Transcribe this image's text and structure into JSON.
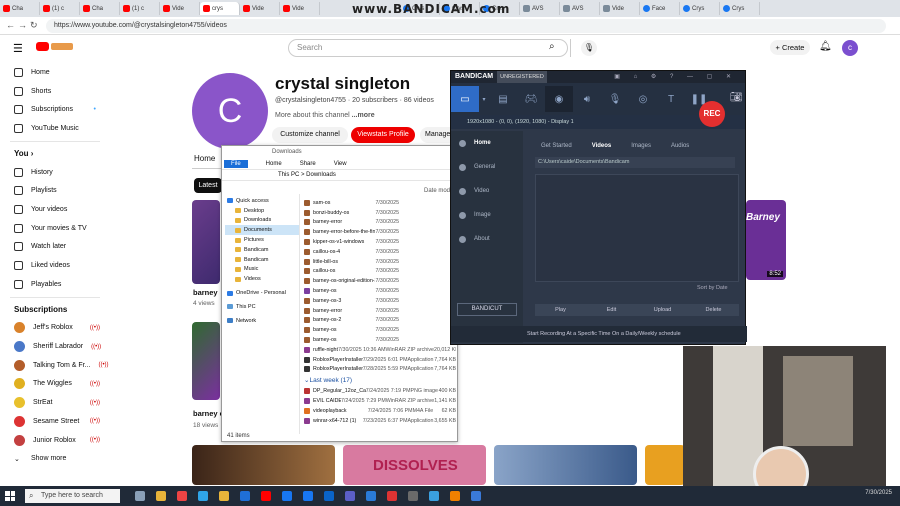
{
  "browser": {
    "tabs": [
      {
        "label": "Cha",
        "icon": "youtube-icon"
      },
      {
        "label": "(1) c",
        "icon": "youtube-icon"
      },
      {
        "label": "Cha",
        "icon": "youtube-icon"
      },
      {
        "label": "(1) c",
        "icon": "youtube-icon"
      },
      {
        "label": "Vide",
        "icon": "youtube-icon"
      },
      {
        "label": "crys",
        "icon": "youtube-icon",
        "active": true
      },
      {
        "label": "Vide",
        "icon": "youtube-icon"
      },
      {
        "label": "Vide",
        "icon": "youtube-icon"
      },
      {
        "label": "Crys",
        "icon": "facebook-icon"
      },
      {
        "label": "Crys",
        "icon": "facebook-icon"
      },
      {
        "label": "Crys",
        "icon": "facebook-icon"
      },
      {
        "label": "AVS",
        "icon": "other-icon"
      },
      {
        "label": "AVS",
        "icon": "other-icon"
      },
      {
        "label": "Vide",
        "icon": "other-icon"
      },
      {
        "label": "Face",
        "icon": "facebook-icon"
      },
      {
        "label": "Crys",
        "icon": "facebook-icon"
      },
      {
        "label": "Crys",
        "icon": "facebook-icon"
      }
    ],
    "watermark": "www.BANDICAM.com",
    "url": "https://www.youtube.com/@crystalsingleton4755/videos"
  },
  "youtube": {
    "search_placeholder": "Search",
    "create_label": "Create",
    "avatar_letter": "c",
    "sidebar": {
      "main": [
        "Home",
        "Shorts",
        "Subscriptions",
        "YouTube Music"
      ],
      "you_heading": "You",
      "you_items": [
        "History",
        "Playlists",
        "Your videos",
        "Your movies & TV",
        "Watch later",
        "Liked videos",
        "Playables"
      ],
      "subs_heading": "Subscriptions",
      "subs": [
        {
          "name": "Jeff's Roblox",
          "color": "#d9822b"
        },
        {
          "name": "Sheriff Labrador",
          "color": "#4a78c8"
        },
        {
          "name": "Talking Tom & Fr...",
          "color": "#b35d2a"
        },
        {
          "name": "The Wiggles",
          "color": "#e0b020"
        },
        {
          "name": "StrEat",
          "color": "#e8c02c"
        },
        {
          "name": "Sesame Street",
          "color": "#d33"
        },
        {
          "name": "Junior Roblox",
          "color": "#c34040"
        }
      ],
      "show_more": "Show more"
    },
    "channel": {
      "avatar_letter": "C",
      "name": "crystal singleton",
      "handle_line": "@crystalsingleton4755 · 20 subscribers · 86 videos",
      "more_about": "More about this channel",
      "more_link": "...more",
      "customize_label": "Customize channel",
      "viewstats_label": "Viewstats Profile",
      "manage_label": "Manage",
      "home_tab": "Home",
      "latest_chip": "Latest",
      "video_a_title": "barney",
      "video_a_meta": "4 views",
      "video_b_title": "barney er",
      "video_b_meta": "18 views",
      "right_thumb_text": "Barney",
      "right_thumb_duration": "8:52",
      "bottom_thumb_text": "DISSOLVES"
    }
  },
  "explorer": {
    "title": "Downloads",
    "ribbon": [
      "File",
      "Home",
      "Share",
      "View"
    ],
    "address": "This PC  >  Downloads",
    "header_date": "Date mod",
    "nav": [
      {
        "label": "Quick access",
        "icon": "star-icon",
        "indent": 0
      },
      {
        "label": "Desktop",
        "icon": "folder-icon",
        "indent": 1
      },
      {
        "label": "Downloads",
        "icon": "folder-icon",
        "indent": 1
      },
      {
        "label": "Documents",
        "icon": "folder-icon",
        "indent": 1,
        "selected": true
      },
      {
        "label": "Pictures",
        "icon": "folder-icon",
        "indent": 1
      },
      {
        "label": "Bandicam",
        "icon": "folder-icon",
        "indent": 1
      },
      {
        "label": "Bandicam",
        "icon": "folder-icon",
        "indent": 1
      },
      {
        "label": "Music",
        "icon": "folder-icon",
        "indent": 1
      },
      {
        "label": "Videos",
        "icon": "folder-icon",
        "indent": 1
      },
      {
        "label": "OneDrive - Personal",
        "icon": "cloud-icon",
        "indent": 0
      },
      {
        "label": "This PC",
        "icon": "pc-icon",
        "indent": 0
      },
      {
        "label": "Network",
        "icon": "network-icon",
        "indent": 0
      }
    ],
    "files": [
      {
        "name": "sam-os",
        "date": "7/30/2025",
        "type": "",
        "size": "",
        "color": "#9c5b2e"
      },
      {
        "name": "bonzi-buddy-os",
        "date": "7/30/2025",
        "type": "",
        "size": "",
        "color": "#9c5b2e"
      },
      {
        "name": "barney-error",
        "date": "7/30/2025",
        "type": "",
        "size": "",
        "color": "#9c5b2e"
      },
      {
        "name": "barney-error-before-the-final",
        "date": "7/30/2025",
        "type": "",
        "size": "",
        "color": "#9c5b2e"
      },
      {
        "name": "kipper-os-v1-windows",
        "date": "7/30/2025",
        "type": "",
        "size": "",
        "color": "#9c5b2e"
      },
      {
        "name": "caillou-os-4",
        "date": "7/30/2025",
        "type": "",
        "size": "",
        "color": "#9c5b2e"
      },
      {
        "name": "little-bill-os",
        "date": "7/30/2025",
        "type": "",
        "size": "",
        "color": "#9c5b2e"
      },
      {
        "name": "caillou-os",
        "date": "7/30/2025",
        "type": "",
        "size": "",
        "color": "#9c5b2e"
      },
      {
        "name": "barney-os-original-edition-2",
        "date": "7/30/2025",
        "type": "",
        "size": "",
        "color": "#9c5b2e"
      },
      {
        "name": "barney-os",
        "date": "7/30/2025",
        "type": "",
        "size": "",
        "color": "#7b3fa0"
      },
      {
        "name": "barney-os-3",
        "date": "7/30/2025",
        "type": "",
        "size": "",
        "color": "#9c5b2e"
      },
      {
        "name": "barney-error",
        "date": "7/30/2025",
        "type": "",
        "size": "",
        "color": "#9c5b2e"
      },
      {
        "name": "barney-os-2",
        "date": "7/30/2025",
        "type": "",
        "size": "",
        "color": "#9c5b2e"
      },
      {
        "name": "barney-os",
        "date": "7/30/2025",
        "type": "",
        "size": "",
        "color": "#9c5b2e"
      },
      {
        "name": "barney-os",
        "date": "7/30/2025",
        "type": "",
        "size": "",
        "color": "#9c5b2e"
      },
      {
        "name": "ruffle-nightly-2025_07_30-windows-x86_64",
        "date": "7/30/2025 10:36 AM",
        "type": "WinRAR ZIP archive",
        "size": "20,012 KB",
        "color": "#8b3a8f"
      },
      {
        "name": "RobloxPlayerInstaller-JG8Y3YP4HJ",
        "date": "7/29/2025 6:01 PM",
        "type": "Application",
        "size": "7,764 KB",
        "color": "#333"
      },
      {
        "name": "RobloxPlayerInstaller-TKKKTGMP37",
        "date": "7/28/2025 5:59 PM",
        "type": "Application",
        "size": "7,764 KB",
        "color": "#333"
      }
    ],
    "group_label": "Last week (17)",
    "files2": [
      {
        "name": "DP_Regular_12oz_Can_Wet",
        "date": "7/24/2025 7:19 PM",
        "type": "PNG image",
        "size": "400 KB",
        "color": "#b33"
      },
      {
        "name": "EVIL CAIDEN DANCE ON THE WATER PARK",
        "date": "7/24/2025 7:29 PM",
        "type": "WinRAR ZIP archive",
        "size": "1,141 KB",
        "color": "#8b3a8f"
      },
      {
        "name": "videoplayback",
        "date": "7/24/2025 7:06 PM",
        "type": "M4A File",
        "size": "62 KB",
        "color": "#e07020"
      },
      {
        "name": "winrar-x64-712 (1)",
        "date": "7/23/2025 6:37 PM",
        "type": "Application",
        "size": "3,655 KB",
        "color": "#8b3a8f"
      }
    ],
    "status": "41 items"
  },
  "bandicam": {
    "logo": "BANDICAM",
    "unregistered": "UNREGISTERED",
    "rec_label": "REC",
    "mode_text": "1920x1080 - (0, 0), (1920, 1080) - Display 1",
    "nav": [
      {
        "label": "Home",
        "selected": true,
        "icon": "home-icon"
      },
      {
        "label": "General",
        "icon": "gear-icon"
      },
      {
        "label": "Video",
        "icon": "video-icon"
      },
      {
        "label": "Image",
        "icon": "image-icon"
      },
      {
        "label": "About",
        "icon": "info-icon"
      }
    ],
    "tabs": [
      "Get Started",
      "Videos",
      "Images",
      "Audios"
    ],
    "selected_tab": "Videos",
    "path": "C:\\Users\\caide\\Documents\\Bandicam",
    "sort_label": "Sort by Date",
    "bandicut_label": "BANDICUT",
    "actions": [
      "Play",
      "Edit",
      "Upload",
      "Delete"
    ],
    "schedule_text": "Start Recording At a Specific Time On a Daily/Weekly schedule"
  },
  "taskbar": {
    "search_placeholder": "Type here to search",
    "apps": [
      {
        "icon": "task-view-icon",
        "color": "#8aa0b8"
      },
      {
        "icon": "file-explorer-icon",
        "color": "#e8b43a"
      },
      {
        "icon": "chrome-icon",
        "color": "#e44"
      },
      {
        "icon": "edge-icon",
        "color": "#2fa4e7"
      },
      {
        "icon": "file-explorer-icon",
        "color": "#e8b43a"
      },
      {
        "icon": "store-icon",
        "color": "#1f6fd6"
      },
      {
        "icon": "youtube-icon",
        "color": "#f00"
      },
      {
        "icon": "facebook-icon",
        "color": "#1877f2"
      },
      {
        "icon": "facebook-icon",
        "color": "#1877f2"
      },
      {
        "icon": "outlook-icon",
        "color": "#0a64c9"
      },
      {
        "icon": "teams-icon",
        "color": "#5b5fc7"
      },
      {
        "icon": "app-icon",
        "color": "#2a7bd8"
      },
      {
        "icon": "bandicam-icon",
        "color": "#d33"
      },
      {
        "icon": "app-icon",
        "color": "#6a6a6a"
      },
      {
        "icon": "image-icon",
        "color": "#3aa0e0"
      },
      {
        "icon": "vlc-icon",
        "color": "#f08000"
      },
      {
        "icon": "app-icon",
        "color": "#3a7ad9"
      }
    ],
    "clock": "7/30/2025"
  },
  "colors": {
    "youtube_red": "#ff0000",
    "bandicam_bg": "#2e3849",
    "bandicam_accent": "#2f6cc7",
    "taskbar": "#202a38"
  }
}
